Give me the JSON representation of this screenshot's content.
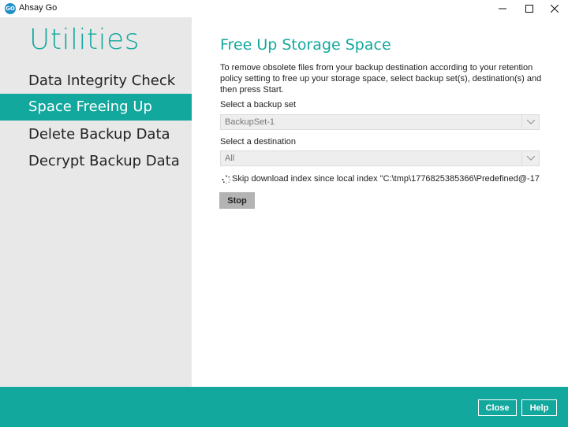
{
  "window": {
    "title": "Ahsay Go",
    "logo_text": "GO",
    "icons": [
      "minimize-icon",
      "maximize-icon",
      "close-icon"
    ]
  },
  "sidebar": {
    "heading": "Utilities",
    "items": [
      {
        "label": "Data Integrity Check",
        "active": false
      },
      {
        "label": "Space Freeing Up",
        "active": true
      },
      {
        "label": "Delete Backup Data",
        "active": false
      },
      {
        "label": "Decrypt Backup Data",
        "active": false
      }
    ]
  },
  "main": {
    "title": "Free Up Storage Space",
    "description": "To remove obsolete files from your backup destination according to your retention policy setting to free up your storage space, select backup set(s), destination(s) and then press Start.",
    "backup_set": {
      "label": "Select a backup set",
      "value": "BackupSet-1"
    },
    "destination": {
      "label": "Select a destination",
      "value": "All"
    },
    "status_text": "Skip download index since local index \"C:\\tmp\\1776825385366\\Predefined@-17...",
    "stop_label": "Stop"
  },
  "footer": {
    "close_label": "Close",
    "help_label": "Help"
  },
  "colors": {
    "accent": "#13a89e",
    "sidebar_bg": "#e8e8e8",
    "stop_button_bg": "#b3b3b3"
  }
}
